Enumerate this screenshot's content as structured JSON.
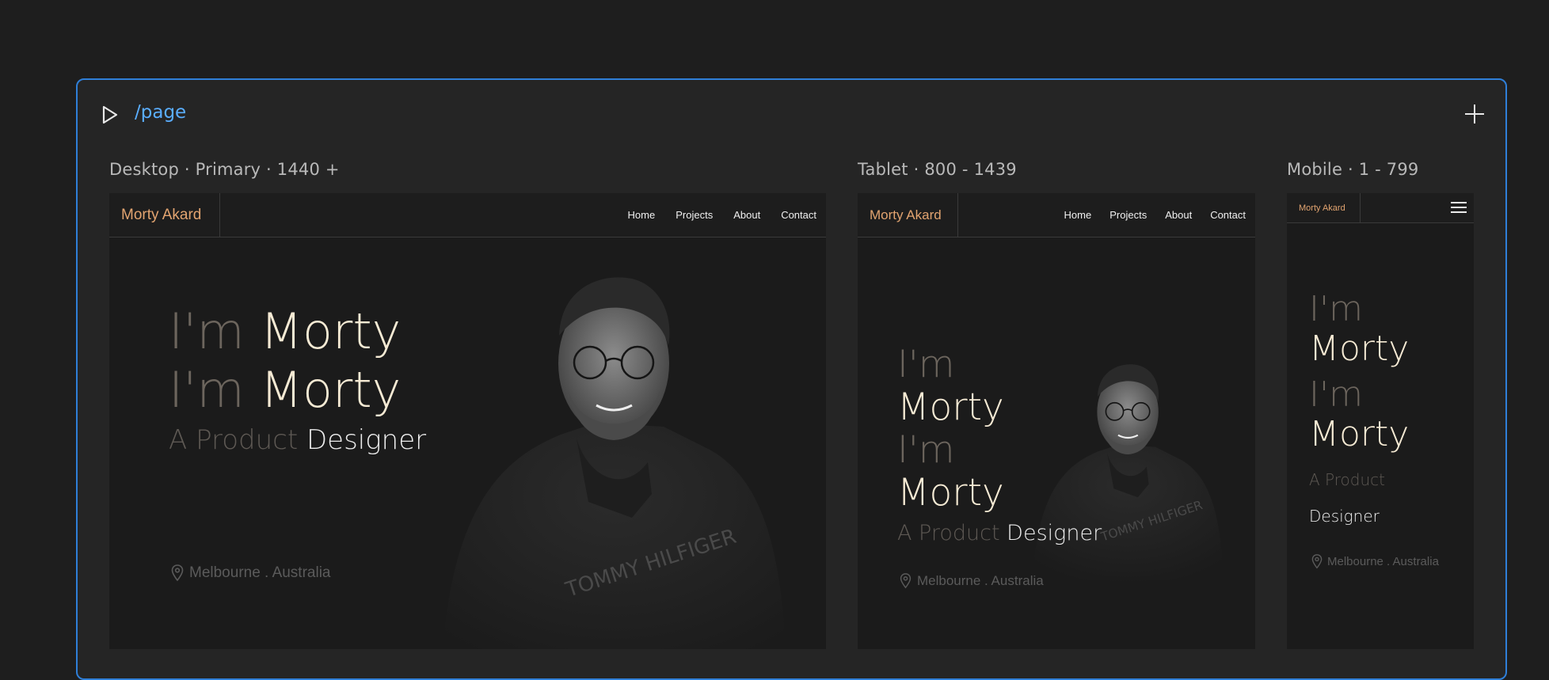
{
  "frame": {
    "path": "/page"
  },
  "breakpoints": {
    "desktop": "Desktop · Primary · 1440 +",
    "tablet": "Tablet · 800 - 1439",
    "mobile": "Mobile · 1 - 799"
  },
  "site": {
    "brand": "Morty Akard",
    "nav": [
      "Home",
      "Projects",
      "About",
      "Contact"
    ],
    "hero": {
      "im": "I'm",
      "name": "Morty",
      "sub_a": "A Product",
      "sub_b": "Designer",
      "location": "Melbourne . Australia"
    }
  },
  "icons": {
    "play": "play-icon",
    "plus": "plus-icon",
    "menu": "hamburger-menu-icon",
    "location": "map-pin-icon"
  },
  "colors": {
    "accent": "#e2a470",
    "frame_border": "#2f7fd8",
    "path": "#5aaeff",
    "cream": "#f5ead4"
  }
}
